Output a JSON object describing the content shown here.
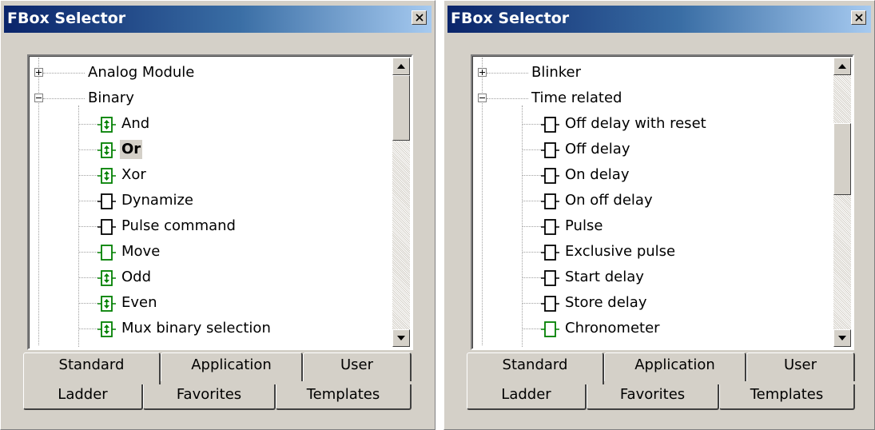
{
  "panels": [
    {
      "title": "FBox Selector",
      "groups": [
        {
          "label": "Analog Module",
          "state": "collapsed"
        },
        {
          "label": "Binary",
          "state": "expanded",
          "children": [
            {
              "label": "And",
              "icon": "green-boxed-arrows"
            },
            {
              "label": "Or",
              "icon": "green-boxed-arrows",
              "selected": true
            },
            {
              "label": "Xor",
              "icon": "green-boxed-arrows"
            },
            {
              "label": "Dynamize",
              "icon": "black-box"
            },
            {
              "label": "Pulse command",
              "icon": "black-box"
            },
            {
              "label": "Move",
              "icon": "green-box"
            },
            {
              "label": "Odd",
              "icon": "green-boxed-arrows"
            },
            {
              "label": "Even",
              "icon": "green-boxed-arrows"
            },
            {
              "label": "Mux binary selection",
              "icon": "green-boxed-arrows"
            }
          ]
        }
      ],
      "tabs_row1": [
        "Standard",
        "Application",
        "User"
      ],
      "tabs_row2": [
        "Ladder",
        "Favorites",
        "Templates"
      ],
      "active_tab": "Standard"
    },
    {
      "title": "FBox Selector",
      "groups": [
        {
          "label": "Blinker",
          "state": "collapsed"
        },
        {
          "label": "Time related",
          "state": "expanded",
          "children": [
            {
              "label": "Off delay with reset",
              "icon": "black-box"
            },
            {
              "label": "Off delay",
              "icon": "black-box"
            },
            {
              "label": "On delay",
              "icon": "black-box"
            },
            {
              "label": "On off delay",
              "icon": "black-box"
            },
            {
              "label": "Pulse",
              "icon": "black-box"
            },
            {
              "label": "Exclusive pulse",
              "icon": "black-box"
            },
            {
              "label": "Start delay",
              "icon": "black-box"
            },
            {
              "label": "Store delay",
              "icon": "black-box"
            },
            {
              "label": "Chronometer",
              "icon": "green-box"
            }
          ]
        }
      ],
      "tabs_row1": [
        "Standard",
        "Application",
        "User"
      ],
      "tabs_row2": [
        "Ladder",
        "Favorites",
        "Templates"
      ],
      "active_tab": "Standard"
    }
  ],
  "icons": {
    "close": "close-icon",
    "scroll_up": "scroll-up-arrow-icon",
    "scroll_down": "scroll-down-arrow-icon",
    "expand": "plus-expander-icon",
    "collapse": "minus-expander-icon"
  },
  "colors": {
    "title_gradient_start": "#0a246a",
    "title_gradient_end": "#a6caf0",
    "face": "#d4d0c8",
    "fbox_green": "#008000"
  }
}
